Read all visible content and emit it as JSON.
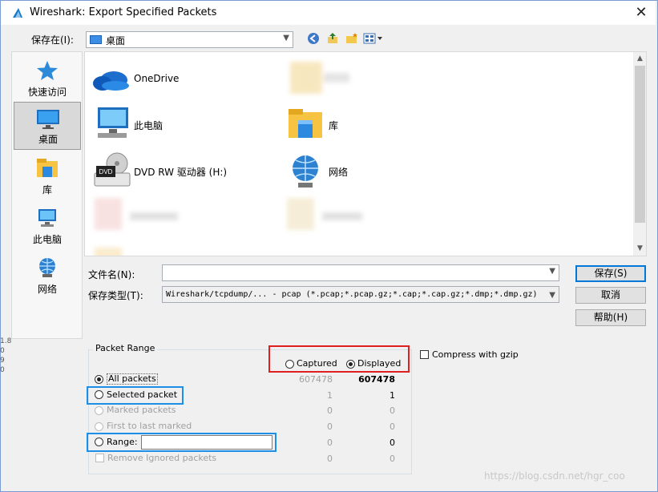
{
  "window": {
    "title": "Wireshark: Export Specified Packets",
    "close_glyph": "✕"
  },
  "save_in": {
    "label": "保存在(I):",
    "value": "桌面"
  },
  "toolbar": {
    "back_icon": "back-arrow-icon",
    "up_icon": "up-folder-icon",
    "new_folder_icon": "new-folder-icon",
    "view_menu_icon": "view-menu-icon"
  },
  "places": [
    {
      "label": "快速访问",
      "icon": "star-icon"
    },
    {
      "label": "桌面",
      "icon": "desktop-icon",
      "selected": true
    },
    {
      "label": "库",
      "icon": "library-icon"
    },
    {
      "label": "此电脑",
      "icon": "computer-icon"
    },
    {
      "label": "网络",
      "icon": "network-icon"
    }
  ],
  "files": [
    {
      "label": "OneDrive",
      "icon": "cloud-icon"
    },
    {
      "label": "",
      "icon": "folder-icon",
      "blurred": true
    },
    {
      "label": "此电脑",
      "icon": "computer-icon"
    },
    {
      "label": "库",
      "icon": "library-icon"
    },
    {
      "label": "DVD RW 驱动器 (H:)",
      "icon": "dvd-icon"
    },
    {
      "label": "网络",
      "icon": "network-icon"
    },
    {
      "label": "",
      "icon": "file-icon",
      "blurred": true
    },
    {
      "label": "",
      "icon": "file-icon",
      "blurred": true
    },
    {
      "label": "",
      "icon": "file-icon",
      "blurred": true
    }
  ],
  "filename": {
    "label": "文件名(N):",
    "value": ""
  },
  "filetype": {
    "label": "保存类型(T):",
    "value": "Wireshark/tcpdump/... - pcap (*.pcap;*.pcap.gz;*.cap;*.cap.gz;*.dmp;*.dmp.gz)"
  },
  "buttons": {
    "save": "保存(S)",
    "cancel": "取消",
    "help": "帮助(H)"
  },
  "packet_range": {
    "title": "Packet Range",
    "captured_label": "Captured",
    "displayed_label": "Displayed",
    "displayed_selected": true,
    "rows": [
      {
        "label": "All packets",
        "captured": "607478",
        "displayed": "607478",
        "checked": true,
        "enabled": true
      },
      {
        "label": "Selected packet",
        "captured": "1",
        "displayed": "1",
        "checked": false,
        "enabled": true
      },
      {
        "label": "Marked packets",
        "captured": "0",
        "displayed": "0",
        "checked": false,
        "enabled": false
      },
      {
        "label": "First to last marked",
        "captured": "0",
        "displayed": "0",
        "checked": false,
        "enabled": false
      },
      {
        "label": "Range:",
        "captured": "0",
        "displayed": "0",
        "checked": false,
        "enabled": true,
        "input_value": ""
      },
      {
        "label": "Remove Ignored packets",
        "captured": "0",
        "displayed": "0",
        "checked": false,
        "enabled": false,
        "checkbox": true
      }
    ]
  },
  "compress": {
    "label": "Compress with gzip",
    "checked": false
  },
  "watermark": "https://blog.csdn.net/hgr_coo",
  "background_fragment": "1.8\n0\n9\n0",
  "colors": {
    "highlight_red": "#e02020",
    "highlight_blue": "#1e8fe6",
    "accent": "#0078d7"
  }
}
